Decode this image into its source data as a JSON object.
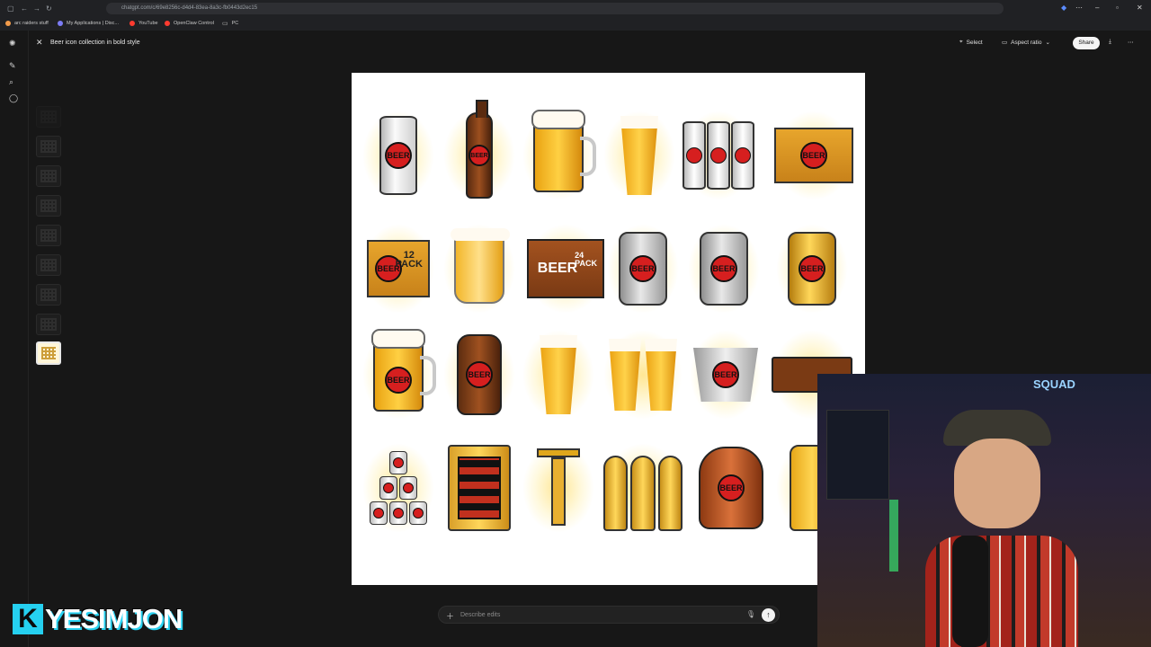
{
  "browser": {
    "url": "chatgpt.com/c/69e8256c-d4d4-83ea-8a3c-fb0443d2ec15",
    "bookmarks": [
      {
        "label": "arc raiders stuff",
        "color": "#f29b4b"
      },
      {
        "label": "My Applications | Disc...",
        "color": "#7c7cf5"
      },
      {
        "label": "YouTube",
        "color": "#ff3b30"
      },
      {
        "label": "OpenClaw Control",
        "color": "#ff3b30"
      },
      {
        "label": "PC",
        "color": "#bbbbbb"
      }
    ]
  },
  "viewer": {
    "title": "Beer icon collection in bold style",
    "select_label": "Select",
    "aspect_label": "Aspect ratio",
    "share_label": "Share"
  },
  "image_grid": {
    "label_text": "BEER",
    "pack12": "12\nPACK",
    "pack24": "24\nPACK",
    "crate_text": "BEER"
  },
  "edit_bar": {
    "placeholder": "Describe edits"
  },
  "overlay": {
    "brand_initial": "K",
    "brand_name": "YESIMJON",
    "neon_sign": "SQUAD"
  },
  "colors": {
    "accent": "#d61f1f",
    "gold": "#ffd043",
    "brand_cyan": "#25d0f0"
  }
}
